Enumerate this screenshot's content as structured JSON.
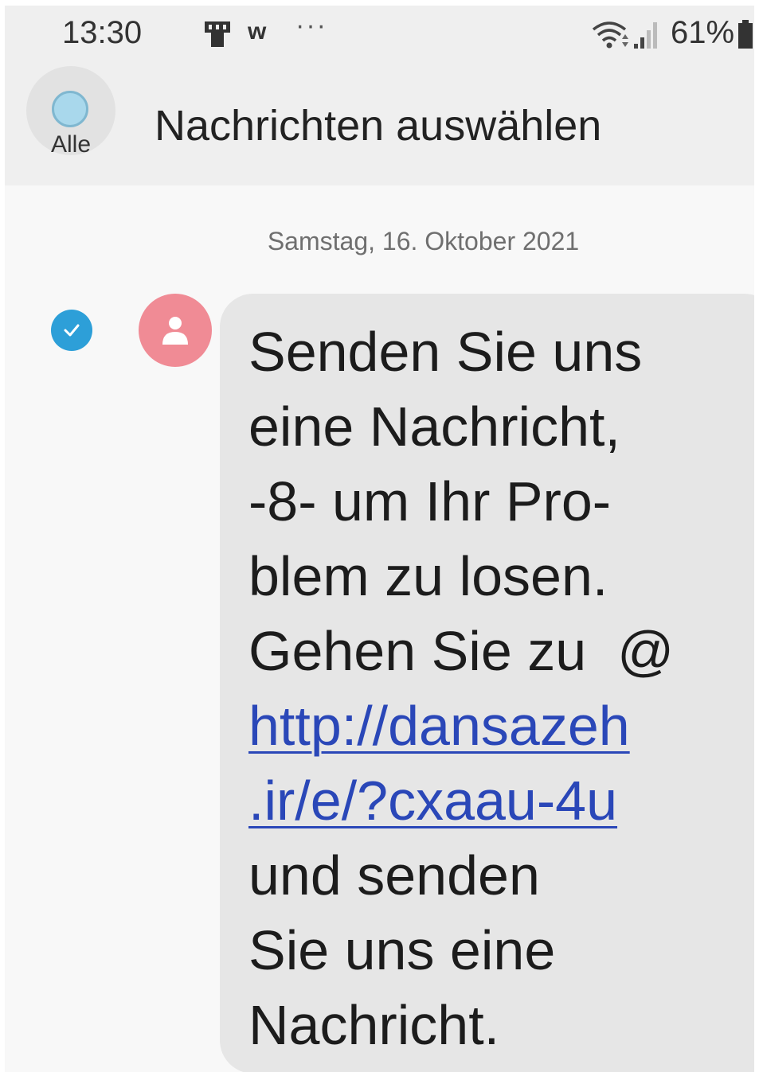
{
  "status_bar": {
    "time": "13:30",
    "w_icon": "w",
    "more": "···",
    "battery": "61%",
    "icons": [
      "notification-icon",
      "wifi-icon",
      "signal-icon",
      "battery-icon"
    ]
  },
  "header": {
    "select_all_label": "Alle",
    "title": "Nachrichten auswählen"
  },
  "conversation": {
    "date": "Samstag, 16. Oktober 2021",
    "message": {
      "selected": true,
      "lines": [
        "Senden Sie uns",
        "eine Nachricht,",
        "-8- um Ihr Pro-",
        "blem zu losen.",
        "Gehen Sie zu  @"
      ],
      "link_lines": [
        "http://dansazeh",
        ".ir/e/?cxaau-4u"
      ],
      "after_lines": [
        "und senden",
        "Sie uns eine",
        "Nachricht."
      ]
    }
  },
  "colors": {
    "background": "#f8f8f8",
    "header_bg": "#efefef",
    "bubble_bg": "#e6e6e6",
    "check": "#2d9fd8",
    "avatar": "#f08b95",
    "link": "#2a47b8"
  }
}
